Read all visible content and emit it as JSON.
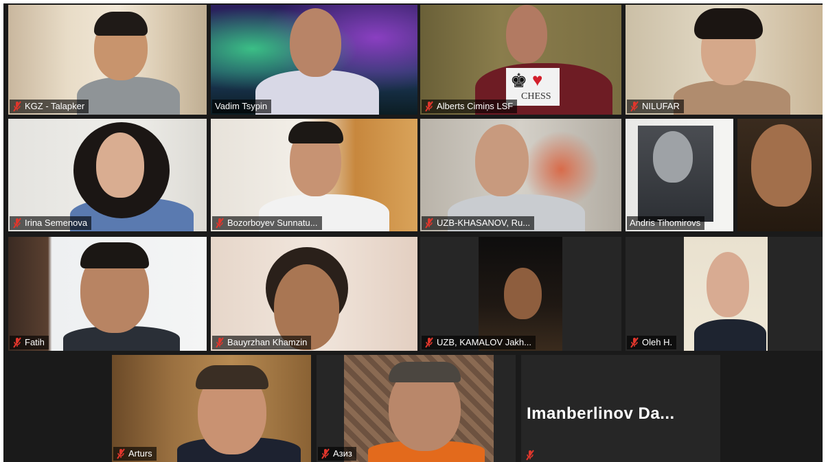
{
  "participants": [
    {
      "name": "KGZ - Talapker",
      "muted": true
    },
    {
      "name": "Vadim Tsypin",
      "muted": false
    },
    {
      "name": "Alberts Cimiņs LSF",
      "muted": true
    },
    {
      "name": "NILUFAR",
      "muted": true
    },
    {
      "name": "Irina Semenova",
      "muted": true
    },
    {
      "name": "Bozorboyev Sunnatu...",
      "muted": true
    },
    {
      "name": "UZB-KHASANOV, Ru...",
      "muted": true
    },
    {
      "name": "Andris Tihomirovs",
      "muted": false
    },
    {
      "name": "Fatih",
      "muted": true
    },
    {
      "name": "Bauyrzhan Khamzin",
      "muted": true
    },
    {
      "name": "UZB, KAMALOV Jakh...",
      "muted": true
    },
    {
      "name": "Oleh H.",
      "muted": true
    },
    {
      "name": "Arturs",
      "muted": true
    },
    {
      "name": "Азиз",
      "muted": true
    },
    {
      "name": "",
      "muted": true
    },
    {
      "name": "",
      "muted": true
    }
  ],
  "no_video_tile": {
    "display_name": "Imanberlinov  Da..."
  },
  "shirt_sign_text": "CHESS",
  "colors": {
    "active_speaker_border": "#e7df3a",
    "muted_mic": "#e0362c",
    "grid_background": "#1a1a1a"
  }
}
